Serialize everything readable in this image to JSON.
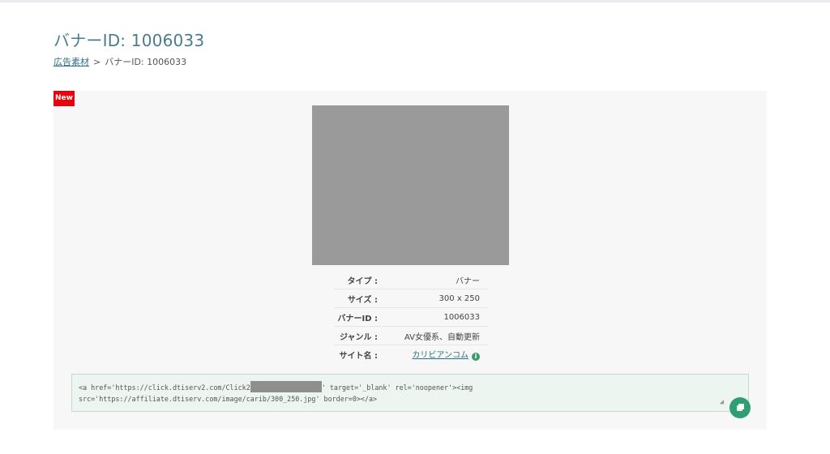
{
  "page": {
    "title": "バナーID: 1006033"
  },
  "breadcrumb": {
    "parent": "広告素材",
    "separator": ">",
    "current": "バナーID: 1006033"
  },
  "banner": {
    "badge": "New",
    "info": [
      {
        "key": "タイプ :",
        "value": "バナー"
      },
      {
        "key": "サイズ :",
        "value": "300 x 250"
      },
      {
        "key": "バナーID :",
        "value": "1006033"
      },
      {
        "key": "ジャンル :",
        "value": "AV女優系、自動更新"
      },
      {
        "key": "サイト名 :",
        "value": "カリビアンコム"
      }
    ],
    "site_info_icon": "i"
  },
  "code": {
    "line1_prefix": "<a href='https://click.dtiserv2.com/Click2",
    "line1_suffix": "' target='_blank' rel='noopener'><img",
    "line2": "src='https://affiliate.dtiserv.com/image/carib/300_250.jpg' border=0></a>",
    "resize_glyph": "◢"
  },
  "colors": {
    "title": "#4b7b8e",
    "link": "#2e6f86",
    "badge": "#e8000b",
    "accent_green": "#2f9e73"
  },
  "icons": {
    "info": "info-circle-icon",
    "copy": "copy-icon"
  }
}
